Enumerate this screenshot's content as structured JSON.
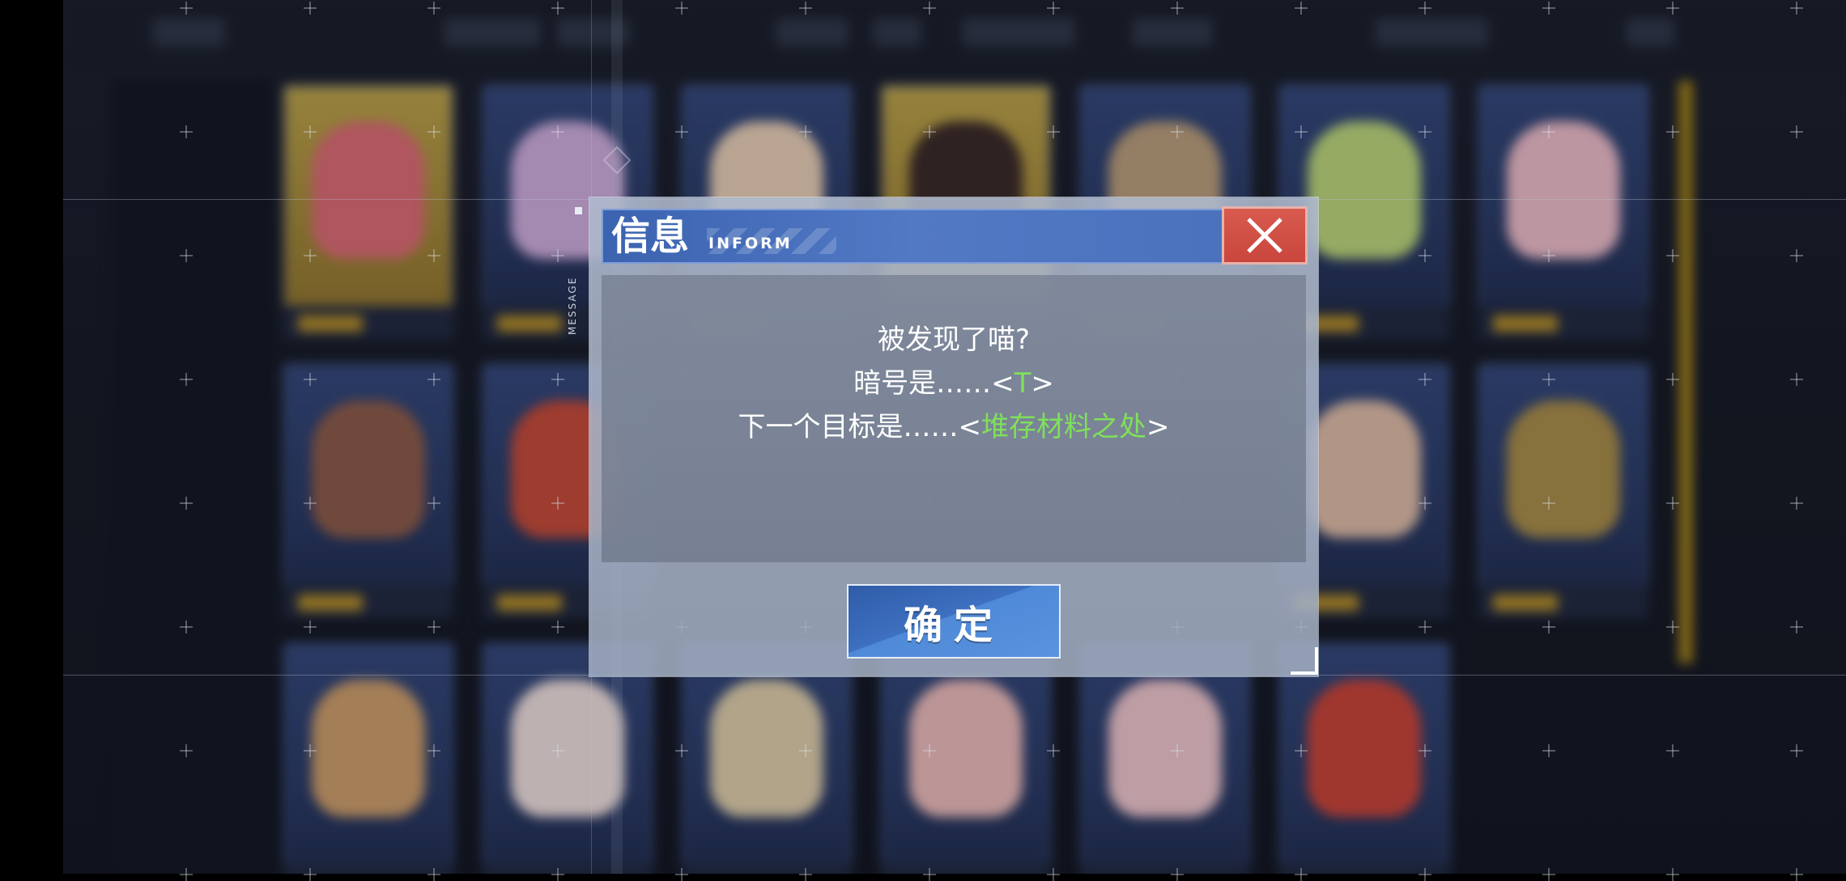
{
  "dialog": {
    "side_tag": "MESSAGE",
    "title": "信息",
    "title_sub": "INFORM",
    "message": {
      "line1": "被发现了喵?",
      "line2_prefix": "暗号是……<",
      "line2_highlight": "T",
      "line2_suffix": ">",
      "line3_prefix": "下一个目标是……<",
      "line3_highlight": "堆存材料之处",
      "line3_suffix": ">"
    },
    "confirm_label": "确定",
    "close_icon": "close-icon"
  },
  "colors": {
    "title_bar": "#4a72bd",
    "close_button": "#d85a4f",
    "highlight_text": "#7fe05a",
    "confirm_button": "#3d70c0"
  }
}
